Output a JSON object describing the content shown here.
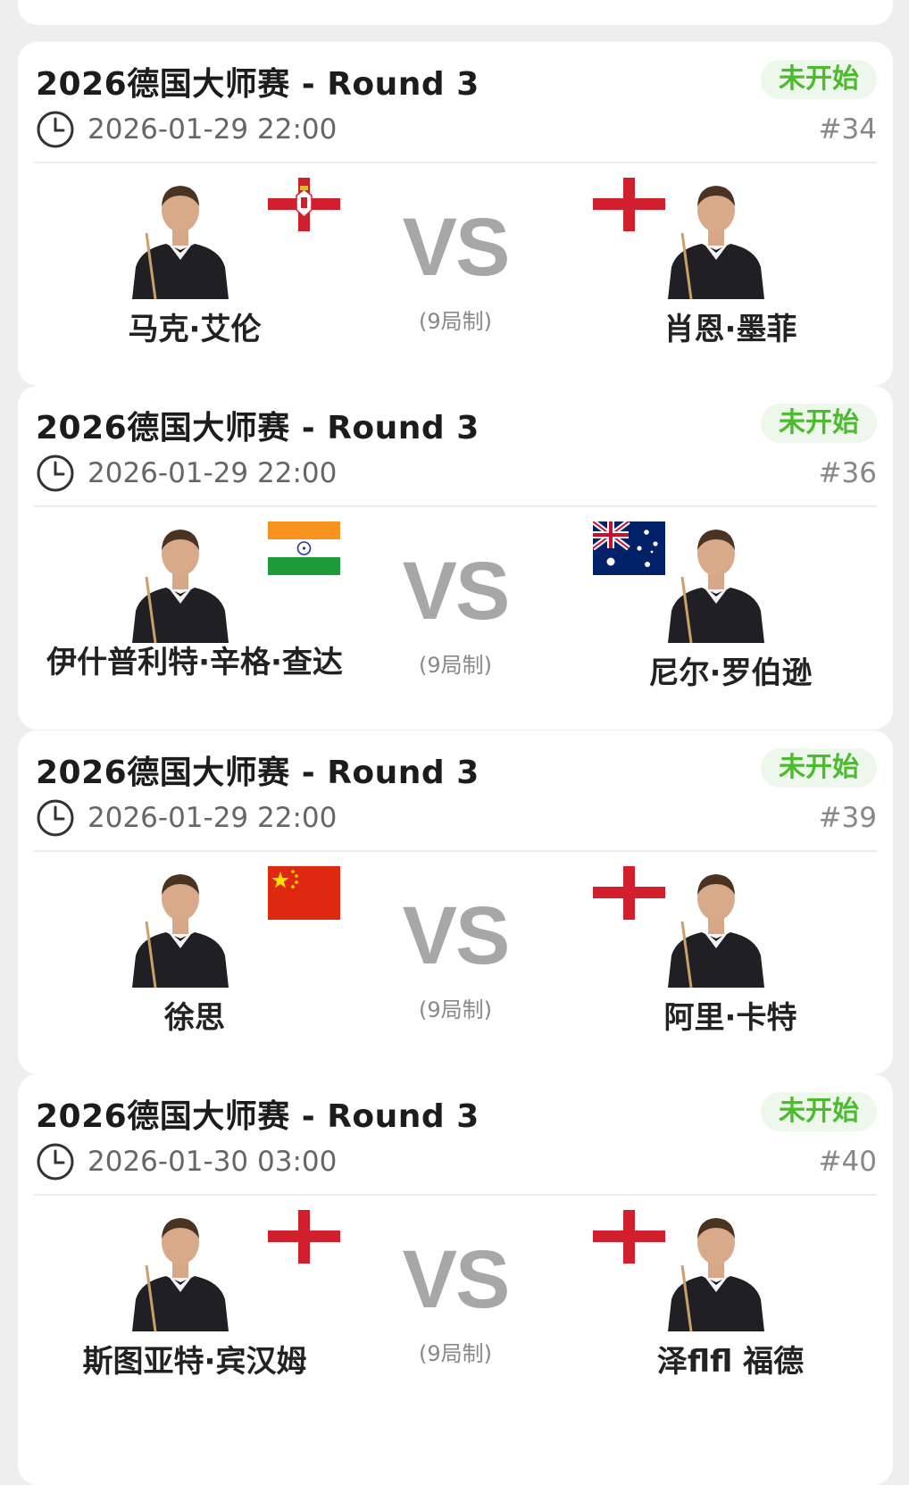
{
  "status_color": "#4dbb2e",
  "matches": [
    {
      "title": "2026德国大师赛 - Round 3",
      "status": "未开始",
      "time": "2026-01-29 22:00",
      "number": "#34",
      "vs": "VS",
      "format": "(9局制)",
      "player1": {
        "name": "马克·艾伦",
        "flag": "northern-ireland-flag"
      },
      "player2": {
        "name": "肖恩·墨菲",
        "flag": "england-flag"
      }
    },
    {
      "title": "2026德国大师赛 - Round 3",
      "status": "未开始",
      "time": "2026-01-29 22:00",
      "number": "#36",
      "vs": "VS",
      "format": "(9局制)",
      "player1": {
        "name": "伊什普利特·辛格·查达",
        "flag": "india-flag"
      },
      "player2": {
        "name": "尼尔·罗伯逊",
        "flag": "australia-flag"
      }
    },
    {
      "title": "2026德国大师赛 - Round 3",
      "status": "未开始",
      "time": "2026-01-29 22:00",
      "number": "#39",
      "vs": "VS",
      "format": "(9局制)",
      "player1": {
        "name": "徐思",
        "flag": "china-flag"
      },
      "player2": {
        "name": "阿里·卡特",
        "flag": "england-flag"
      }
    },
    {
      "title": "2026德国大师赛 - Round 3",
      "status": "未开始",
      "time": "2026-01-30 03:00",
      "number": "#40",
      "vs": "VS",
      "format": "(9局制)",
      "player1": {
        "name": "斯图亚特·宾汉姆",
        "flag": "england-flag"
      },
      "player2": {
        "name": "泽flfl 福德",
        "flag": "england-flag"
      }
    }
  ]
}
